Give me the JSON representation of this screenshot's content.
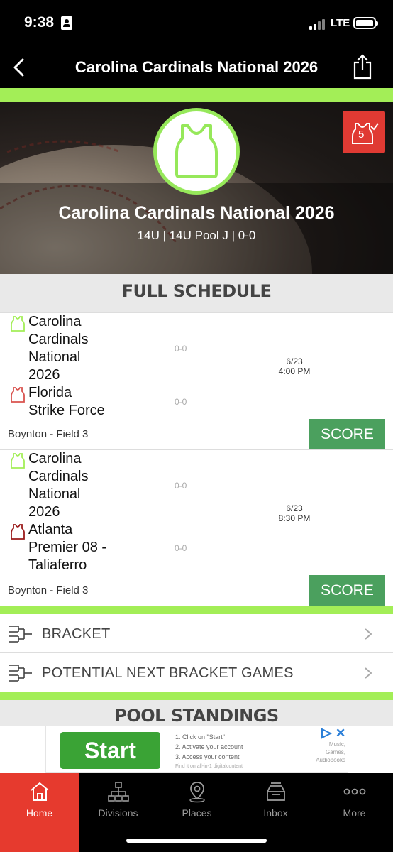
{
  "status_bar": {
    "time": "9:38",
    "network": "LTE"
  },
  "header": {
    "title": "Carolina Cardinals National 2026"
  },
  "colors": {
    "accent_green": "#a3ee57",
    "alert_red": "#e03a33",
    "score_green": "#4ba05e",
    "tab_active": "#e63a2e"
  },
  "hero": {
    "title": "Carolina Cardinals National 2026",
    "subtitle": "14U | 14U Pool J | 0-0",
    "badge_count": "5"
  },
  "schedule": {
    "heading": "FULL SCHEDULE",
    "games": [
      {
        "team1": {
          "name_lines": [
            "Carolina",
            "Cardinals",
            "National",
            "2026"
          ],
          "record": "0-0",
          "icon": "jersey-icon-green"
        },
        "team2": {
          "name_lines": [
            "Florida",
            "Strike Force"
          ],
          "record": "0-0",
          "icon": "jersey-icon-red"
        },
        "date": "6/23",
        "time": "4:00 PM",
        "field": "Boynton - Field 3",
        "button": "SCORE"
      },
      {
        "team1": {
          "name_lines": [
            "Carolina",
            "Cardinals",
            "National",
            "2026"
          ],
          "record": "0-0",
          "icon": "jersey-icon-green"
        },
        "team2": {
          "name_lines": [
            "Atlanta",
            "Premier 08 -",
            "Taliaferro"
          ],
          "record": "0-0",
          "icon": "jersey-icon-darkred"
        },
        "date": "6/23",
        "time": "8:30 PM",
        "field": "Boynton - Field 3",
        "button": "SCORE"
      }
    ]
  },
  "links": [
    {
      "label": "BRACKET",
      "icon": "bracket-icon"
    },
    {
      "label": "POTENTIAL NEXT BRACKET GAMES",
      "icon": "bracket-icon"
    }
  ],
  "standings": {
    "heading": "POOL STANDINGS"
  },
  "ad": {
    "button": "Start",
    "steps": [
      "1. Click on \"Start\"",
      "2. Activate your account",
      "3. Access your content"
    ],
    "fine_print": "Find it on all-in-1 digitalcontent",
    "side_lines": [
      "Music,",
      "Games,",
      "Audiobooks"
    ]
  },
  "tabs": [
    {
      "label": "Home",
      "icon": "home-icon",
      "active": true
    },
    {
      "label": "Divisions",
      "icon": "divisions-icon",
      "active": false
    },
    {
      "label": "Places",
      "icon": "places-icon",
      "active": false
    },
    {
      "label": "Inbox",
      "icon": "inbox-icon",
      "active": false
    },
    {
      "label": "More",
      "icon": "more-icon",
      "active": false
    }
  ]
}
